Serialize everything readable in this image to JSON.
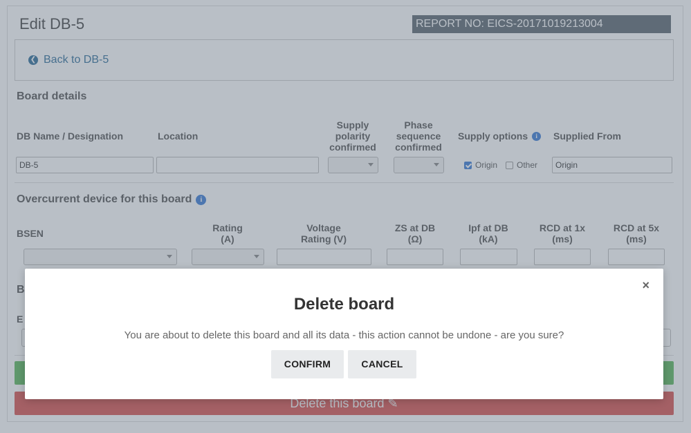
{
  "page": {
    "title": "Edit DB-5",
    "report_no": "REPORT NO: EICS-20171019213004",
    "back_link": "Back to DB-5"
  },
  "board_details": {
    "heading": "Board details",
    "labels": {
      "db_name": "DB Name / Designation",
      "location": "Location",
      "supply_polarity_1": "Supply",
      "supply_polarity_2": "polarity",
      "supply_polarity_3": "confirmed",
      "phase_seq_1": "Phase",
      "phase_seq_2": "sequence",
      "phase_seq_3": "confirmed",
      "supply_options": "Supply options",
      "supplied_from": "Supplied From"
    },
    "values": {
      "db_name": "DB-5",
      "location": "",
      "supplied_from": "Origin"
    },
    "supply_options": {
      "origin_label": "Origin",
      "origin_checked": true,
      "other_label": "Other",
      "other_checked": false
    }
  },
  "overcurrent": {
    "heading": "Overcurrent device for this board",
    "labels": {
      "bsen": "BSEN",
      "rating_1": "Rating",
      "rating_2": "(A)",
      "voltage_1": "Voltage",
      "voltage_2": "Rating (V)",
      "zs_1": "ZS at DB",
      "zs_2": "(Ω)",
      "ipf_1": "Ipf at DB",
      "ipf_2": "(kA)",
      "rcd1_1": "RCD at 1x",
      "rcd1_2": "(ms)",
      "rcd5_1": "RCD at 5x",
      "rcd5_2": "(ms)"
    }
  },
  "background": {
    "partial_heading": "B",
    "partial_label": "E",
    "delete_button": "Delete this board"
  },
  "modal": {
    "title": "Delete board",
    "message": "You are about to delete this board and all its data - this action cannot be undone - are you sure?",
    "confirm": "CONFIRM",
    "cancel": "CANCEL",
    "close": "×"
  },
  "colors": {
    "report_bg": "#5b6670",
    "link": "#2f6d9a",
    "info": "#3a7bd5",
    "success": "#5cb85c",
    "danger": "#d9534f",
    "overlay": "rgba(100,112,128,0.45)"
  }
}
